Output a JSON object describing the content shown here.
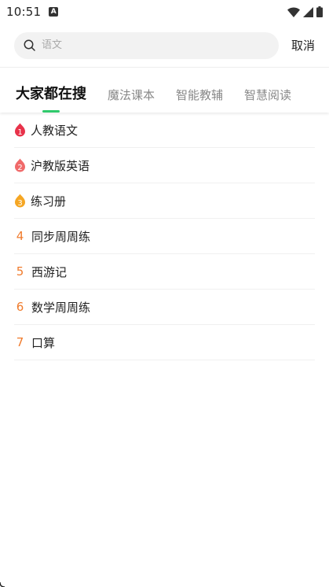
{
  "status": {
    "time": "10:51",
    "notif_letter": "A"
  },
  "search": {
    "placeholder": "语文",
    "cancel_label": "取消"
  },
  "tabs": [
    {
      "label": "大家都在搜",
      "active": true
    },
    {
      "label": "魔法课本",
      "active": false
    },
    {
      "label": "智能教辅",
      "active": false
    },
    {
      "label": "智慧阅读",
      "active": false
    }
  ],
  "hot_list": [
    {
      "rank": "1",
      "text": "人教语文",
      "badge_color": "#e8324a"
    },
    {
      "rank": "2",
      "text": "沪教版英语",
      "badge_color": "#f06a6a"
    },
    {
      "rank": "3",
      "text": "练习册",
      "badge_color": "#f5a623"
    },
    {
      "rank": "4",
      "text": "同步周周练"
    },
    {
      "rank": "5",
      "text": "西游记"
    },
    {
      "rank": "6",
      "text": "数学周周练"
    },
    {
      "rank": "7",
      "text": "口算"
    }
  ],
  "colors": {
    "accent": "#2fc96b",
    "rank_text": "#f07b2c"
  }
}
